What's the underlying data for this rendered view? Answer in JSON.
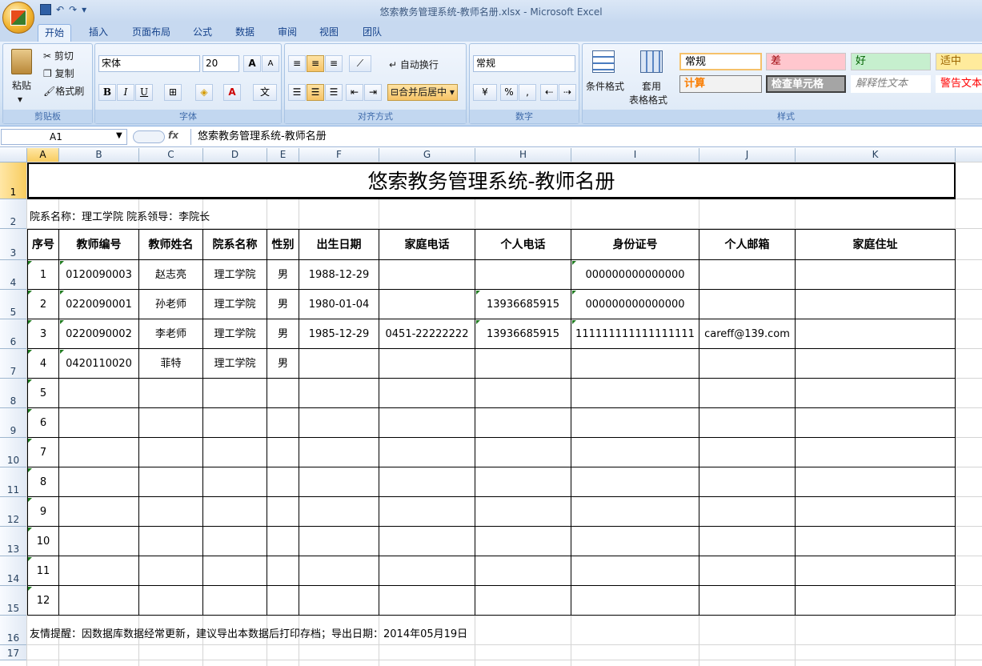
{
  "window": {
    "title": "悠索教务管理系统-教师名册.xlsx - Microsoft Excel",
    "qat_undo": "↶",
    "qat_redo": "↷"
  },
  "tabs": [
    "开始",
    "插入",
    "页面布局",
    "公式",
    "数据",
    "审阅",
    "视图",
    "团队"
  ],
  "ribbon": {
    "clipboard": {
      "label": "剪贴板",
      "paste": "粘贴",
      "cut": "剪切",
      "copy": "复制",
      "painter": "格式刷"
    },
    "font": {
      "label": "字体",
      "name": "宋体",
      "size": "20",
      "grow": "A",
      "shrink": "A",
      "bold": "B",
      "italic": "I",
      "underline": "U"
    },
    "align": {
      "label": "对齐方式",
      "wrap": "自动换行",
      "merge": "合并后居中"
    },
    "number": {
      "label": "数字",
      "format": "常规",
      "pct": "%",
      "comma": ","
    },
    "styles": {
      "label": "样式",
      "cond": "条件格式",
      "table1": "套用",
      "table2": "表格格式",
      "s1": "常规",
      "s2": "差",
      "s3": "好",
      "s4": "适中",
      "s5": "计算",
      "s6": "检查单元格",
      "s7": "解释性文本",
      "s8": "警告文本"
    }
  },
  "formula_bar": {
    "cell_ref": "A1",
    "fx": "fx",
    "content": "悠索教务管理系统-教师名册"
  },
  "columns": [
    "A",
    "B",
    "C",
    "D",
    "E",
    "F",
    "G",
    "H",
    "I",
    "J",
    "K"
  ],
  "rows": [
    "1",
    "2",
    "3",
    "4",
    "5",
    "6",
    "7",
    "8",
    "9",
    "10",
    "11",
    "12",
    "13",
    "14",
    "15",
    "16",
    "17"
  ],
  "sheet": {
    "title": "悠索教务管理系统-教师名册",
    "info": "院系名称：理工学院 院系领导：李院长",
    "headers": [
      "序号",
      "教师编号",
      "教师姓名",
      "院系名称",
      "性别",
      "出生日期",
      "家庭电话",
      "个人电话",
      "身份证号",
      "个人邮箱",
      "家庭住址"
    ],
    "records": [
      [
        "1",
        "0120090003",
        "赵志亮",
        "理工学院",
        "男",
        "1988-12-29",
        "",
        "",
        "000000000000000",
        "",
        ""
      ],
      [
        "2",
        "0220090001",
        "孙老师",
        "理工学院",
        "男",
        "1980-01-04",
        "",
        "13936685915",
        "000000000000000",
        "",
        ""
      ],
      [
        "3",
        "0220090002",
        "李老师",
        "理工学院",
        "男",
        "1985-12-29",
        "0451-22222222",
        "13936685915",
        "111111111111111111",
        "careff@139.com",
        ""
      ],
      [
        "4",
        "0420110020",
        "菲特",
        "理工学院",
        "男",
        "",
        "",
        "",
        "",
        "",
        ""
      ],
      [
        "5",
        "",
        "",
        "",
        "",
        "",
        "",
        "",
        "",
        "",
        ""
      ],
      [
        "6",
        "",
        "",
        "",
        "",
        "",
        "",
        "",
        "",
        "",
        ""
      ],
      [
        "7",
        "",
        "",
        "",
        "",
        "",
        "",
        "",
        "",
        "",
        ""
      ],
      [
        "8",
        "",
        "",
        "",
        "",
        "",
        "",
        "",
        "",
        "",
        ""
      ],
      [
        "9",
        "",
        "",
        "",
        "",
        "",
        "",
        "",
        "",
        "",
        ""
      ],
      [
        "10",
        "",
        "",
        "",
        "",
        "",
        "",
        "",
        "",
        "",
        ""
      ],
      [
        "11",
        "",
        "",
        "",
        "",
        "",
        "",
        "",
        "",
        "",
        ""
      ],
      [
        "12",
        "",
        "",
        "",
        "",
        "",
        "",
        "",
        "",
        "",
        ""
      ]
    ],
    "footer": "友情提醒：因数据库数据经常更新，建议导出本数据后打印存档；导出日期：2014年05月19日"
  }
}
